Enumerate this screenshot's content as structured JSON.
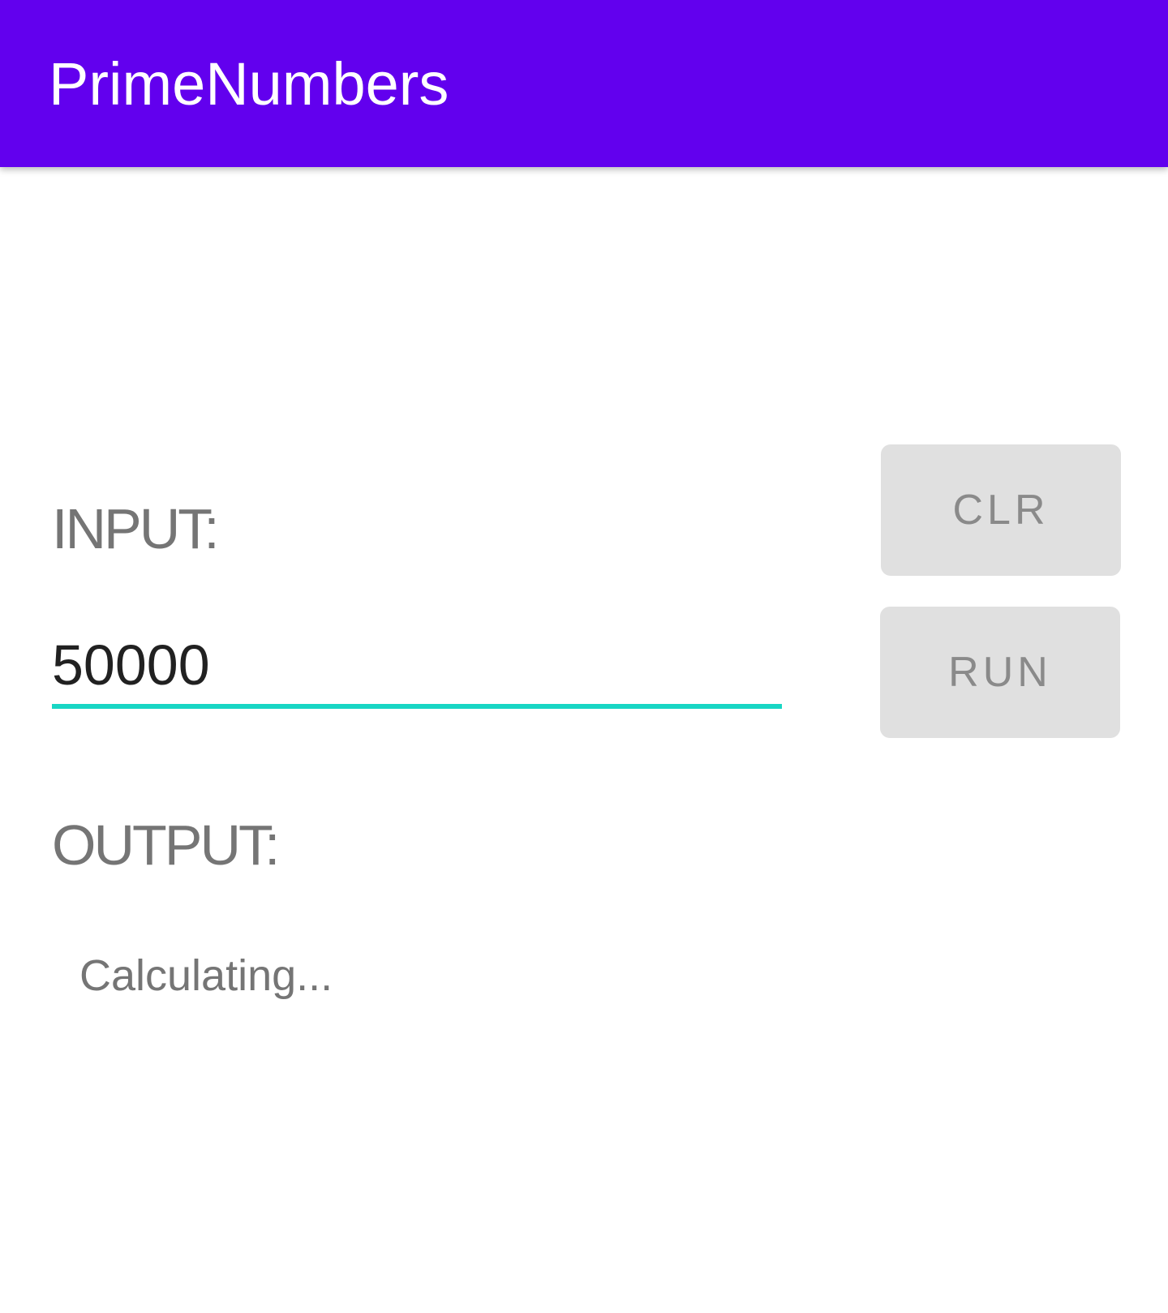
{
  "app_bar": {
    "title": "PrimeNumbers",
    "color": "#6200ee"
  },
  "input_section": {
    "label": "INPUT:",
    "field_value": "50000",
    "underline_color": "#18d6c4"
  },
  "buttons": {
    "clear_label": "CLR",
    "run_label": "RUN"
  },
  "output_section": {
    "label": "OUTPUT:",
    "status_text": "Calculating..."
  }
}
